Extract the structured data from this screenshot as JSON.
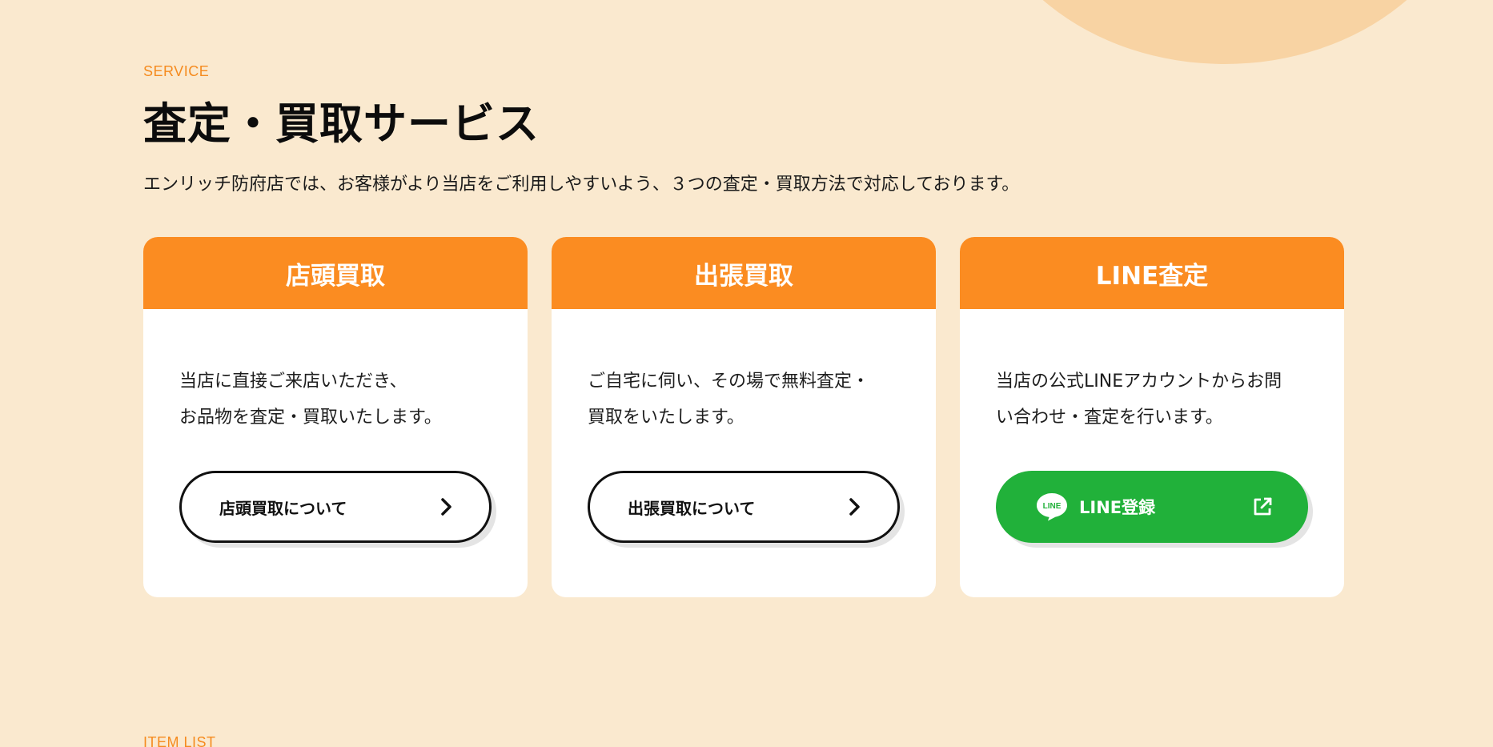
{
  "service": {
    "eyebrow": "SERVICE",
    "title": "査定・買取サービス",
    "lead": "エンリッチ防府店では、お客様がより当店をご利用しやすいよう、３つの査定・買取方法で対応しております。"
  },
  "cards": [
    {
      "title": "店頭買取",
      "text_lines": [
        "当店に直接ご来店いただき、",
        "お品物を査定・買取いたします。"
      ],
      "button_label": "店頭買取について",
      "button_icon": "chevron-right-icon"
    },
    {
      "title": "出張買取",
      "text_lines": [
        "ご自宅に伺い、その場で無料査定・",
        "買取をいたします。"
      ],
      "button_label": "出張買取について",
      "button_icon": "chevron-right-icon"
    },
    {
      "title": "LINE査定",
      "text_lines": [
        "当店の公式LINEアカウントからお問",
        "い合わせ・査定を行います。"
      ],
      "button_label": "LINE登録",
      "button_icon": "external-link-icon",
      "logo_icon": "line-logo-icon",
      "logo_text": "LINE"
    }
  ],
  "next_section": {
    "eyebrow": "ITEM LIST"
  },
  "colors": {
    "background": "#fae9cf",
    "accent_orange": "#fb8c21",
    "line_green": "#21b13a",
    "deco_circle": "#f8d3a3"
  }
}
